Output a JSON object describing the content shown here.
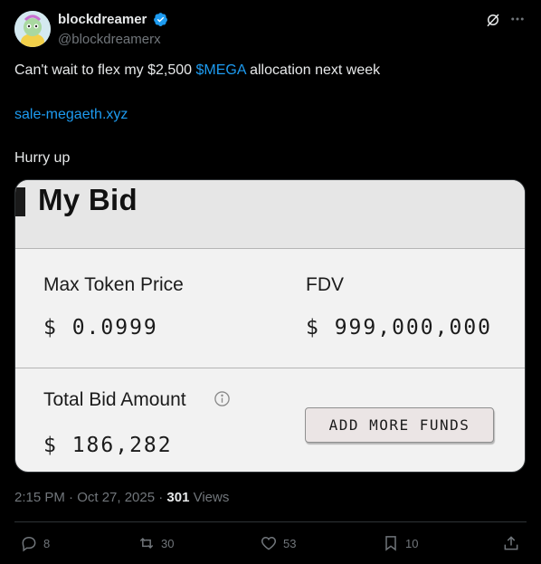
{
  "author": {
    "name": "blockdreamer",
    "handle": "@blockdreamerx"
  },
  "tweet": {
    "line1_before": "Can't wait to flex my $2,500 ",
    "line1_cashtag": "$MEGA",
    "line1_after": " allocation next week",
    "link": "sale-megaeth.xyz",
    "line3": "Hurry up"
  },
  "card": {
    "title": "My Bid",
    "max_token_price_label": "Max Token Price",
    "max_token_price_value": "$ 0.0999",
    "fdv_label": "FDV",
    "fdv_value": "$ 999,000,000",
    "total_bid_label": "Total Bid Amount",
    "total_bid_value": "$ 186,282",
    "add_funds_label": "ADD MORE FUNDS"
  },
  "meta": {
    "time": "2:15 PM · Oct 27, 2025 · ",
    "views_count": "301",
    "views_label": " Views"
  },
  "actions": {
    "replies": "8",
    "reposts": "30",
    "likes": "53",
    "bookmarks": "10"
  },
  "colors": {
    "link": "#1d9bf0",
    "verified": "#1d9bf0",
    "background": "#000000"
  }
}
